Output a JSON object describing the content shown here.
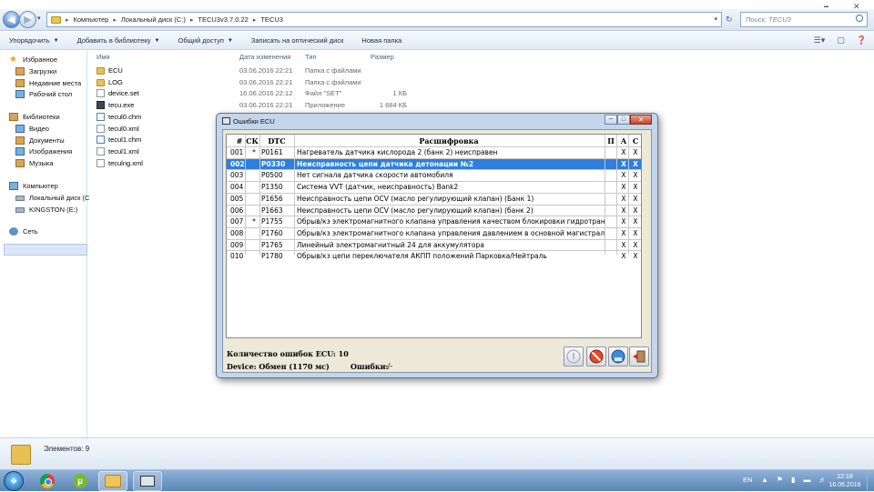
{
  "address": {
    "crumbs": [
      "Компьютер",
      "Локальный диск (C:)",
      "TECU3v3.7.0.22",
      "TECU3"
    ],
    "search_placeholder": "Поиск: TECU3"
  },
  "toolbar": {
    "organize": "Упорядочить",
    "add_library": "Добавить в библиотеку",
    "share": "Общий доступ",
    "burn": "Записать на оптический диск",
    "new_folder": "Новая папка"
  },
  "nav": {
    "favorites": "Избранное",
    "downloads": "Загрузки",
    "recent": "Недавние места",
    "desktop": "Рабочий стол",
    "libraries": "Библиотеки",
    "video": "Видео",
    "documents": "Документы",
    "images": "Изображения",
    "music": "Музыка",
    "computer": "Компьютер",
    "local_disk": "Локальный диск (C",
    "kingston": "KINGSTON (E:)",
    "network": "Сеть"
  },
  "columns": {
    "name": "Имя",
    "date": "Дата изменения",
    "type": "Тип",
    "size": "Размер"
  },
  "files": [
    {
      "name": "ECU",
      "date": "03.06.2016 22:21",
      "type": "Папка с файлами",
      "size": "",
      "icon": "folder"
    },
    {
      "name": "LOG",
      "date": "03.06.2016 22:21",
      "type": "Папка с файлами",
      "size": "",
      "icon": "folder"
    },
    {
      "name": "device.set",
      "date": "16.06.2016 22:12",
      "type": "Файл \"SET\"",
      "size": "1 КБ",
      "icon": "doc"
    },
    {
      "name": "tecu.exe",
      "date": "03.06.2016 22:21",
      "type": "Приложение",
      "size": "1 684 КБ",
      "icon": "exe"
    },
    {
      "name": "tecul0.chm",
      "date": "",
      "type": "",
      "size": "",
      "icon": "chm"
    },
    {
      "name": "tecul0.xml",
      "date": "",
      "type": "",
      "size": "",
      "icon": "doc"
    },
    {
      "name": "tecul1.chm",
      "date": "",
      "type": "",
      "size": "",
      "icon": "chm"
    },
    {
      "name": "tecul1.xml",
      "date": "",
      "type": "",
      "size": "",
      "icon": "doc"
    },
    {
      "name": "teculng.xml",
      "date": "",
      "type": "",
      "size": "",
      "icon": "doc"
    }
  ],
  "status": {
    "items": "Элементов: 9"
  },
  "taskbar": {
    "lang": "EN",
    "time": "22:18",
    "date": "16.06.2016"
  },
  "dialog": {
    "title": "Ошибки ECU",
    "headers": {
      "num": "#",
      "ck": "СК",
      "dtc": "DTC",
      "desc": "Расшифровка",
      "p": "П",
      "a": "А",
      "c": "С"
    },
    "rows": [
      {
        "num": "001",
        "ck": "*",
        "dtc": "P0161",
        "desc": "Нагреватель датчика кислорода 2 (банк 2) неисправен",
        "a": "X",
        "c": "X"
      },
      {
        "num": "002",
        "ck": "",
        "dtc": "P0330",
        "desc": "Неисправность цепи датчика детонации №2",
        "a": "X",
        "c": "X"
      },
      {
        "num": "003",
        "ck": "",
        "dtc": "P0500",
        "desc": "Нет сигнала датчика скорости автомобиля",
        "a": "X",
        "c": "X"
      },
      {
        "num": "004",
        "ck": "",
        "dtc": "P1350",
        "desc": "Система VVT (датчик, неисправность) Bank2",
        "a": "X",
        "c": "X"
      },
      {
        "num": "005",
        "ck": "",
        "dtc": "P1656",
        "desc": "Неисправность цепи OCV (масло регулирующий клапан) (Банк 1)",
        "a": "X",
        "c": "X"
      },
      {
        "num": "006",
        "ck": "",
        "dtc": "P1663",
        "desc": "Неисправность цепи OCV (масло регулирующий клапан) (банк 2)",
        "a": "X",
        "c": "X"
      },
      {
        "num": "007",
        "ck": "*",
        "dtc": "P1755",
        "desc": "Обрыв/кз электромагнитного клапана управления качеством блокировки гидротран",
        "a": "X",
        "c": "X"
      },
      {
        "num": "008",
        "ck": "",
        "dtc": "P1760",
        "desc": "Обрыв/кз электромагнитного клапана управления давлением в основной магистрал",
        "a": "X",
        "c": "X"
      },
      {
        "num": "009",
        "ck": "",
        "dtc": "P1765",
        "desc": "Линейный электромагнитный 24 для аккумулятора",
        "a": "X",
        "c": "X"
      },
      {
        "num": "010",
        "ck": "",
        "dtc": "P1780",
        "desc": "Обрыв/кз цепи переключателя АКПП положений Парковка/Нейтраль",
        "a": "X",
        "c": "X"
      }
    ],
    "selected_index": 1,
    "error_count": "Количество ошибок ECU: 10",
    "device_status": "Device: Обмен (1170 мс)",
    "errors_label": "Ошибки:",
    "errors_value": "-/-"
  }
}
